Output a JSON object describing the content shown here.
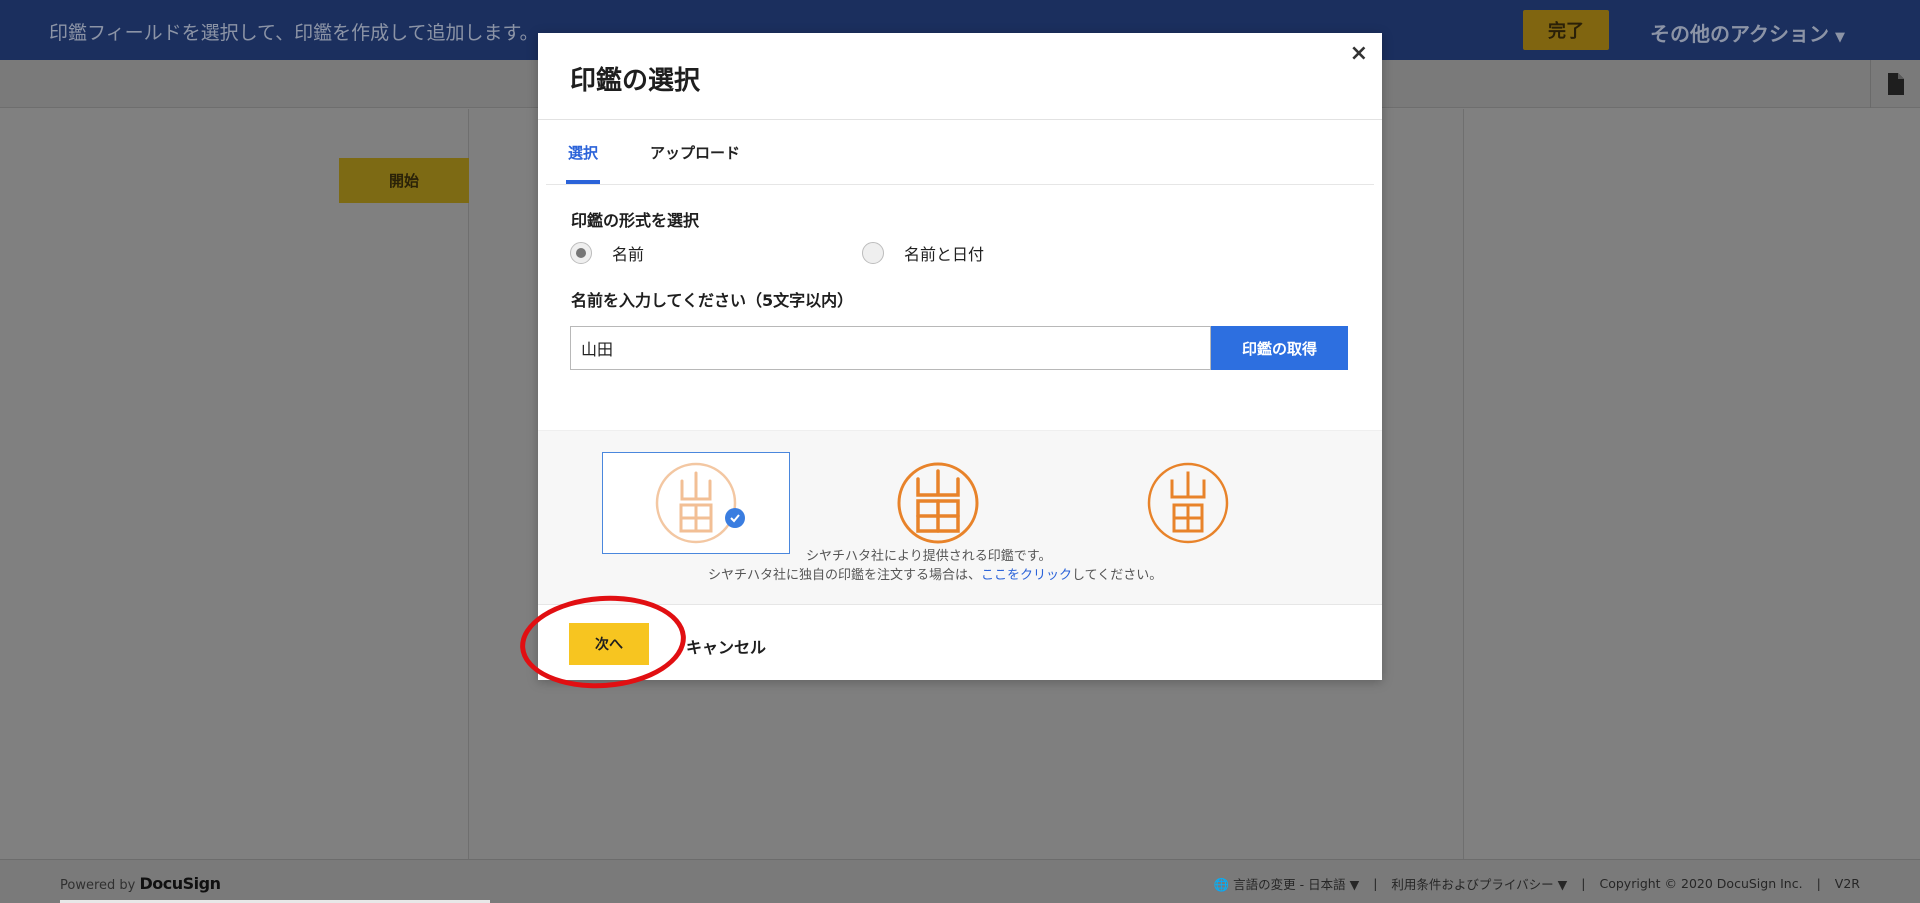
{
  "topbar": {
    "instruction": "印鑑フィールドを選択して、印鑑を作成して追加します。",
    "done_label": "完了",
    "more_actions_label": "その他のアクション"
  },
  "document": {
    "start_tag_label": "開始"
  },
  "modal": {
    "title": "印鑑の選択",
    "close_glyph": "×",
    "tabs": [
      {
        "label": "選択",
        "active": true
      },
      {
        "label": "アップロード",
        "active": false
      }
    ],
    "format_label": "印鑑の形式を選択",
    "format_options": [
      {
        "label": "名前",
        "selected": true
      },
      {
        "label": "名前と日付",
        "selected": false
      }
    ],
    "name_label": "名前を入力してください（5文字以内）",
    "name_value": "山田",
    "get_seal_label": "印鑑の取得",
    "seal_character": "山田",
    "seal_styles": [
      {
        "selected": true,
        "color": "#e8832a"
      },
      {
        "selected": false,
        "color": "#e8832a"
      },
      {
        "selected": false,
        "color": "#e8832a"
      }
    ],
    "note_line1": "シヤチハタ社により提供される印鑑です。",
    "note_line2_prefix": "シヤチハタ社に独自の印鑑を注文する場合は、",
    "note_link": "ここをクリック",
    "note_line2_suffix": "してください。",
    "next_label": "次へ",
    "cancel_label": "キャンセル"
  },
  "footer": {
    "powered_by": "Powered by",
    "brand": "DocuSign",
    "language": "言語の変更 - 日本語",
    "terms": "利用条件およびプライバシー",
    "copyright": "Copyright © 2020 DocuSign Inc.",
    "version": "V2R"
  },
  "colors": {
    "accent_blue": "#2b63d9",
    "button_yellow": "#f7c520",
    "seal_orange": "#e8832a",
    "annotation_red": "#e10f12",
    "topbar_navy": "#1b2f5e"
  }
}
